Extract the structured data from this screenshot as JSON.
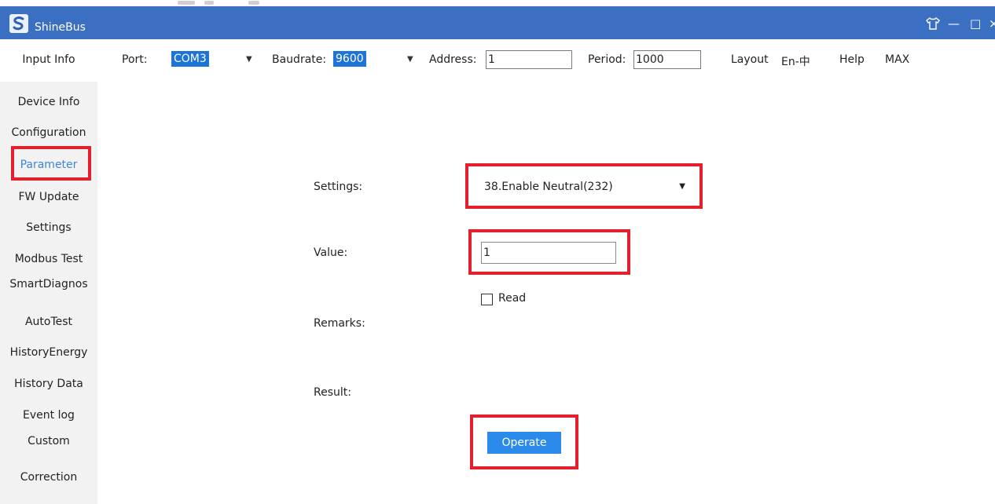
{
  "app": {
    "title": "ShineBus",
    "logo_glyph": "S"
  },
  "window_controls": {
    "skin_glyph": "👕",
    "minimize_glyph": "—",
    "maximize_glyph": "□",
    "close_glyph": "×"
  },
  "toolbar": {
    "input_info": "Input Info",
    "port_label": "Port:",
    "port_value": "COM3",
    "baudrate_label": "Baudrate:",
    "baudrate_value": "9600",
    "address_label": "Address:",
    "address_value": "1",
    "period_label": "Period:",
    "period_value": "1000",
    "menu": [
      "Layout",
      "En-中",
      "Help",
      "MAX"
    ]
  },
  "sidebar": {
    "items": [
      {
        "label": "Device Info"
      },
      {
        "label": "Configuration"
      },
      {
        "label": "Parameter",
        "active": true
      },
      {
        "label": "FW Update"
      },
      {
        "label": "Settings"
      },
      {
        "label": "Modbus Test"
      },
      {
        "label": "SmartDiagnos"
      },
      {
        "label": "AutoTest"
      },
      {
        "label": "HistoryEnergy"
      },
      {
        "label": "History Data"
      },
      {
        "label": "Event log"
      },
      {
        "label": "Custom"
      },
      {
        "label": "Correction"
      }
    ]
  },
  "form": {
    "settings_label": "Settings:",
    "settings_value": "38.Enable Neutral(232)",
    "value_label": "Value:",
    "value_value": "1",
    "read_label": "Read",
    "remarks_label": "Remarks:",
    "result_label": "Result:",
    "operate_label": "Operate"
  },
  "colors": {
    "titlebar": "#3a6fc1",
    "accent": "#2c8bea",
    "highlight": "#e5202e",
    "active_text": "#3b86dc"
  },
  "icons": {
    "dropdown": "chevron-down-icon",
    "skin": "skin-icon"
  }
}
